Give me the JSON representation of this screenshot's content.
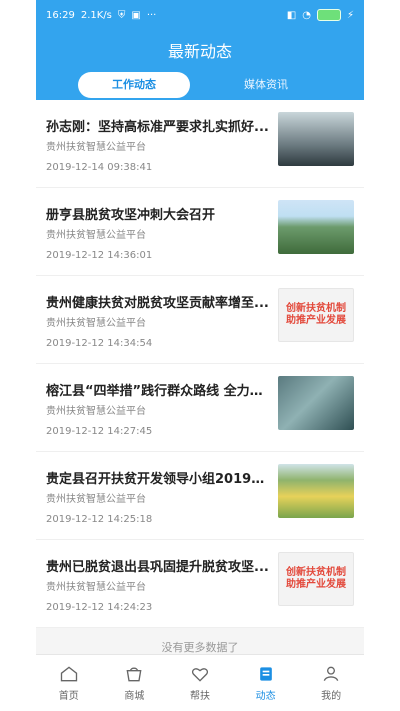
{
  "status": {
    "time": "16:29",
    "speed": "2.1K/s",
    "dots": "···"
  },
  "header": {
    "title": "最新动态",
    "tabs": [
      {
        "label": "工作动态"
      },
      {
        "label": "媒体资讯"
      }
    ]
  },
  "news": [
    {
      "title": "孙志刚：坚持高标准严要求扎实抓好...",
      "source": "贵州扶贫智慧公益平台",
      "date": "2019-12-14 09:38:41"
    },
    {
      "title": "册亨县脱贫攻坚冲刺大会召开",
      "source": "贵州扶贫智慧公益平台",
      "date": "2019-12-12 14:36:01"
    },
    {
      "title": "贵州健康扶贫对脱贫攻坚贡献率增至...",
      "source": "贵州扶贫智慧公益平台",
      "date": "2019-12-12 14:34:54"
    },
    {
      "title": "榕江县“四举措”践行群众路线 全力以...",
      "source": "贵州扶贫智慧公益平台",
      "date": "2019-12-12 14:27:45"
    },
    {
      "title": "贵定县召开扶贫开发领导小组2019年...",
      "source": "贵州扶贫智慧公益平台",
      "date": "2019-12-12 14:25:18"
    },
    {
      "title": "贵州已脱贫退出县巩固提升脱贫攻坚...",
      "source": "贵州扶贫智慧公益平台",
      "date": "2019-12-12 14:24:23"
    }
  ],
  "posters": {
    "line1": "创新扶贫机制",
    "line2": "助推产业发展"
  },
  "footer_hint": "没有更多数据了",
  "tabbar": [
    {
      "label": "首页"
    },
    {
      "label": "商城"
    },
    {
      "label": "帮扶"
    },
    {
      "label": "动态"
    },
    {
      "label": "我的"
    }
  ]
}
